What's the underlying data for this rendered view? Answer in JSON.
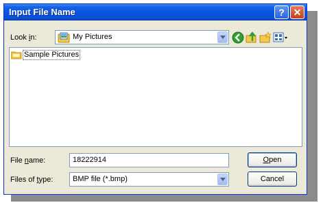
{
  "window": {
    "title": "Input File Name",
    "help_label": "?",
    "close_label": "✕"
  },
  "look_in": {
    "label_prefix": "Look ",
    "label_key": "i",
    "label_suffix": "n:",
    "value": "My Pictures",
    "icon": "my-pictures-folder-icon"
  },
  "toolbar": {
    "icons": [
      "back-icon",
      "up-one-level-icon",
      "new-folder-icon",
      "view-menu-icon"
    ],
    "colors": {
      "back": "#2fa12f",
      "folder": "#f2c94c"
    }
  },
  "file_list": {
    "items": [
      {
        "label": "Sample Pictures",
        "icon": "folder-icon"
      }
    ]
  },
  "file_name": {
    "label_prefix": "File ",
    "label_key": "n",
    "label_suffix": "ame:",
    "value": "18222914"
  },
  "file_type": {
    "label_prefix": "Files of ",
    "label_key": "t",
    "label_suffix": "ype:",
    "value": "BMP file (*.bmp)"
  },
  "buttons": {
    "open_key": "O",
    "open_rest": "pen",
    "cancel": "Cancel"
  },
  "theme": {
    "titlebar": "#0a54e0",
    "dialog_bg": "#ece9d8",
    "field_border": "#7f9db9"
  }
}
